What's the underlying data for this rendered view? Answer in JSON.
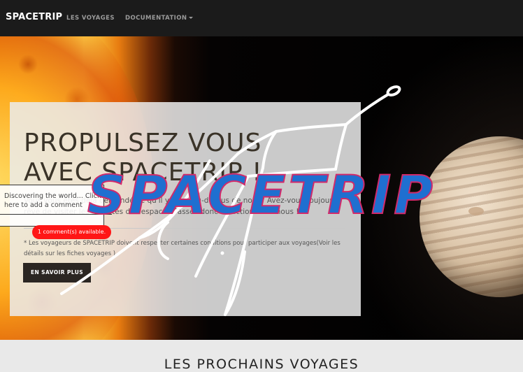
{
  "navbar": {
    "brand": "SPACETRIP",
    "links": [
      {
        "label": "LES VOYAGES"
      },
      {
        "label": "DOCUMENTATION"
      }
    ]
  },
  "hero": {
    "title_line1": "PROPULSEZ VOUS",
    "title_line2": "AVEC SPACETRIP !",
    "lead": "Vous vous êtes déjà demandé ce qu'il y avait au-dessus de nous? Avez-vous toujours rêvé de visiter les planètes de l'espace? Passez donc à l'action avec nous !",
    "note": "* Les voyageurs de SPACETRIP doivent respecter certaines conditions pour participer aux voyages(Voir les détails sur les fiches voyages ).",
    "button": "EN SAVOIR PLUS"
  },
  "comment": {
    "text": "Discovering the world... Click here to add a comment",
    "badge": "1 comment(s) available."
  },
  "logo": {
    "text": "SPACETRIP",
    "fill": "#1f6fd0",
    "stroke": "#d12a6a"
  },
  "section": {
    "title": "LES PROCHAINS VOYAGES"
  }
}
